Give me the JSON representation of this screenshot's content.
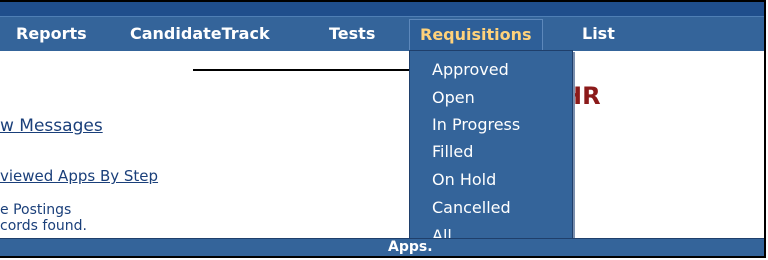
{
  "navbar": {
    "items": [
      {
        "label": "Reports"
      },
      {
        "label": "CandidateTrack"
      },
      {
        "label": "Tests"
      },
      {
        "label": "Requisitions"
      },
      {
        "label": "List"
      }
    ]
  },
  "requisitions_menu": {
    "items": [
      "Approved",
      "Open",
      "In Progress",
      "Filled",
      "On Hold",
      "Cancelled",
      "All"
    ]
  },
  "content": {
    "messages_link": "w Messages",
    "apps_by_step_link": "viewed Apps By Step",
    "postings_label": "e Postings",
    "records_text": "cords found.",
    "hr_title": "HR"
  },
  "bottom_bar": {
    "label": "Apps."
  }
}
